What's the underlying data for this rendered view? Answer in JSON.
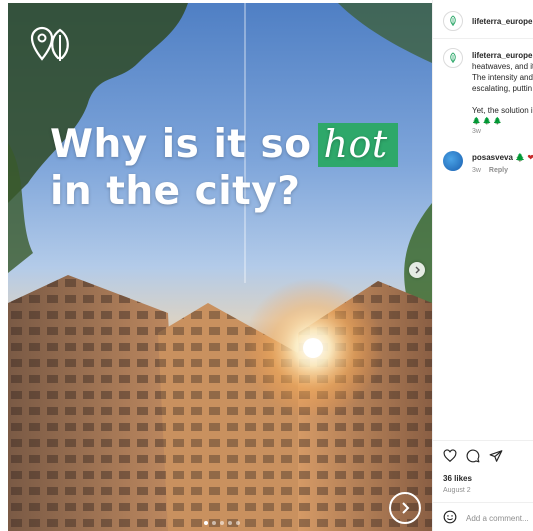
{
  "post": {
    "headline": {
      "line1": "Why is it so",
      "highlight": "hot",
      "line2": "in the city?"
    },
    "highlight_color": "#2ea86a"
  },
  "header": {
    "username": "lifeterra_europe"
  },
  "caption": {
    "username": "lifeterra_europe",
    "lines": [
      "heatwaves, and it",
      "The intensity and",
      "escalating, puttin"
    ],
    "line_after": "Yet, the solution i",
    "emojis": "🌲 🌲 🌲",
    "time": "3w"
  },
  "comment": {
    "username": "posasveva",
    "emojis": "🌲 ❤",
    "time": "3w",
    "reply_label": "Reply"
  },
  "footer": {
    "likes": "36 likes",
    "date": "August 2",
    "add_comment_placeholder": "Add a comment..."
  },
  "carousel": {
    "slide_count": 5,
    "active_index": 0
  },
  "icons": {
    "logo": "lifeterra-pin-leaf-logo",
    "like": "heart-icon",
    "comment": "comment-bubble-icon",
    "share": "paper-plane-icon",
    "next": "chevron-right-icon",
    "emoji": "smiley-icon"
  }
}
